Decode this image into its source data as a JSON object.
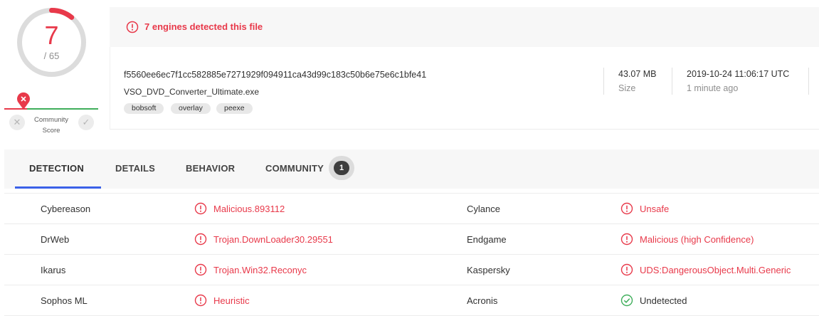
{
  "score": {
    "detected": "7",
    "total": "/ 65",
    "fraction": 0.1077
  },
  "community": {
    "label_line1": "Community",
    "label_line2": "Score",
    "down_icon": "x-icon",
    "up_icon": "check-icon"
  },
  "header": {
    "alert_text": "7 engines detected this file",
    "hash": "f5560ee6ec7f1cc582885e7271929f094911ca43d99c183c50b6e75e6c1bfe41",
    "filename": "VSO_DVD_Converter_Ultimate.exe",
    "tags": [
      "bobsoft",
      "overlay",
      "peexe"
    ],
    "size_value": "43.07 MB",
    "size_label": "Size",
    "date_value": "2019-10-24 11:06:17 UTC",
    "date_label": "1 minute ago"
  },
  "tabs": {
    "detection": "DETECTION",
    "details": "DETAILS",
    "behavior": "BEHAVIOR",
    "community": "COMMUNITY",
    "community_count": "1",
    "active": "DETECTION"
  },
  "detections": [
    {
      "left": {
        "engine": "Cybereason",
        "result": "Malicious.893112",
        "status": "malicious"
      },
      "right": {
        "engine": "Cylance",
        "result": "Unsafe",
        "status": "malicious"
      }
    },
    {
      "left": {
        "engine": "DrWeb",
        "result": "Trojan.DownLoader30.29551",
        "status": "malicious"
      },
      "right": {
        "engine": "Endgame",
        "result": "Malicious (high Confidence)",
        "status": "malicious"
      }
    },
    {
      "left": {
        "engine": "Ikarus",
        "result": "Trojan.Win32.Reconyc",
        "status": "malicious"
      },
      "right": {
        "engine": "Kaspersky",
        "result": "UDS:DangerousObject.Multi.Generic",
        "status": "malicious"
      }
    },
    {
      "left": {
        "engine": "Sophos ML",
        "result": "Heuristic",
        "status": "malicious"
      },
      "right": {
        "engine": "Acronis",
        "result": "Undetected",
        "status": "undetected"
      }
    }
  ],
  "colors": {
    "malicious": "#e8394a",
    "clean": "#3fae5b",
    "accent": "#3b61e8"
  }
}
